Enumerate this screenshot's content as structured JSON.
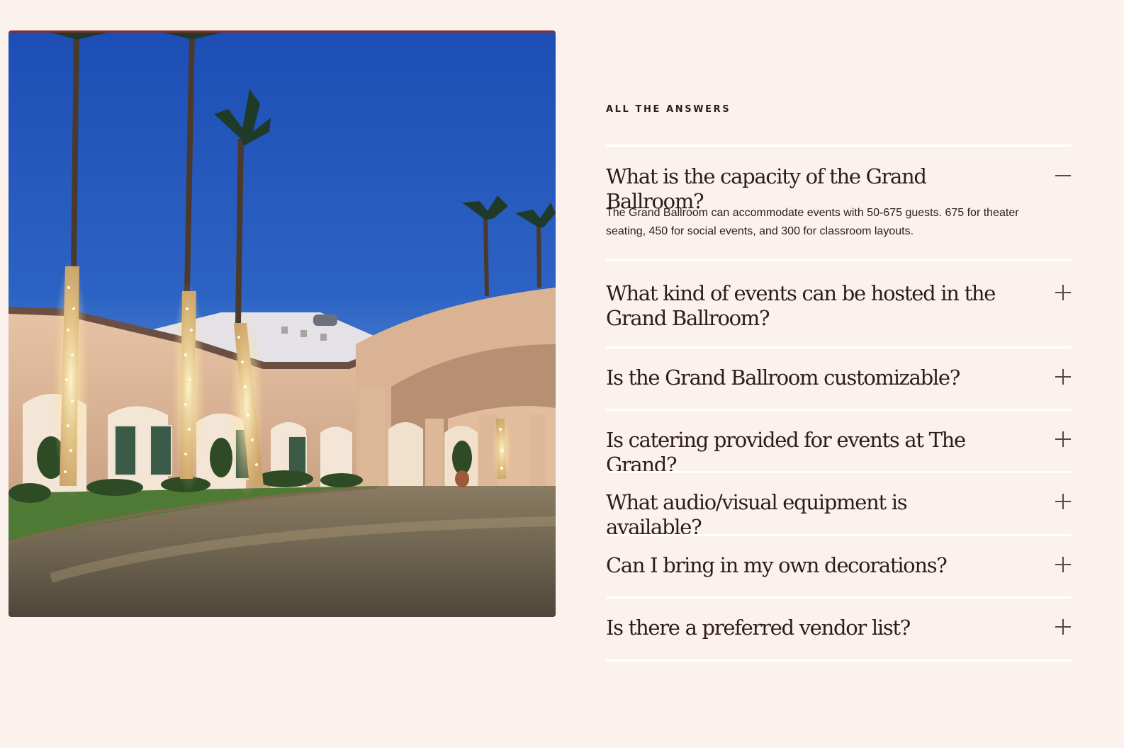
{
  "image": {
    "alt": "Resort entrance at dusk with light-wrapped palm trees"
  },
  "faq": {
    "eyebrow": "ALL THE ANSWERS",
    "items": [
      {
        "question": "What is the capacity of the Grand Ballroom?",
        "expanded": true,
        "toggle_icon": "minus-icon",
        "answer": "The Grand Ballroom can accommodate events with 50-675 guests. 675 for theater seating, 450 for social events, and 300 for classroom layouts."
      },
      {
        "question": "What kind of events can be hosted in the Grand Ballroom?",
        "expanded": false,
        "toggle_icon": "plus-icon"
      },
      {
        "question": "Is the Grand Ballroom customizable?",
        "expanded": false,
        "toggle_icon": "plus-icon"
      },
      {
        "question": "Is catering provided for events at The Grand?",
        "expanded": false,
        "toggle_icon": "plus-icon"
      },
      {
        "question": "What audio/visual equipment is available?",
        "expanded": false,
        "toggle_icon": "plus-icon"
      },
      {
        "question": "Can I bring in my own decorations?",
        "expanded": false,
        "toggle_icon": "plus-icon"
      },
      {
        "question": "Is there a preferred vendor list?",
        "expanded": false,
        "toggle_icon": "plus-icon"
      }
    ]
  },
  "colors": {
    "background": "#fbf2ee",
    "text": "#2e1c1a",
    "divider": "#ffffff",
    "photo_accent": "#8c2b2b"
  }
}
